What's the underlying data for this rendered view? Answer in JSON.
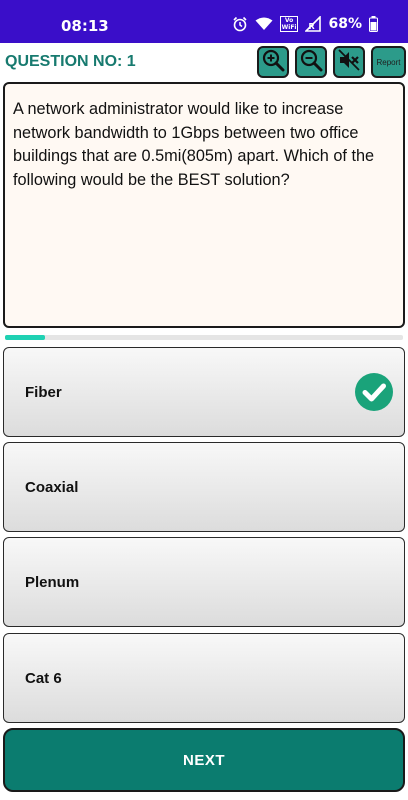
{
  "status_bar": {
    "time": "08:13",
    "vowifi_line1": "Vo",
    "vowifi_line2": "WiFi",
    "signal_sub": "R",
    "battery": "68%",
    "icons": [
      "alarm-icon",
      "wifi-icon",
      "vowifi-icon",
      "signal-icon",
      "battery-icon"
    ]
  },
  "header": {
    "question_number": "QUESTION NO: 1",
    "zoom_in_icon": "zoom-in-icon",
    "zoom_out_icon": "zoom-out-icon",
    "mute_icon": "speaker-mute-icon",
    "report_label": "Report"
  },
  "question": {
    "text": "A network administrator would like to increase network bandwidth to 1Gbps between two office buildings that are 0.5mi(805m) apart. Which of the following would be the BEST solution?"
  },
  "progress": {
    "fraction": 0.1
  },
  "options": [
    {
      "label": "Fiber",
      "selected_correct": true
    },
    {
      "label": "Coaxial",
      "selected_correct": false
    },
    {
      "label": "Plenum",
      "selected_correct": false
    },
    {
      "label": "Cat 6",
      "selected_correct": false
    }
  ],
  "next_button": {
    "label": "NEXT"
  },
  "colors": {
    "status_bar": "#3a0ec9",
    "accent_teal": "#177a6f",
    "button_teal": "#0b7c6f",
    "icon_button": "#2c9b8a",
    "progress": "#1fd1b3",
    "check_green": "#1aa37a"
  }
}
